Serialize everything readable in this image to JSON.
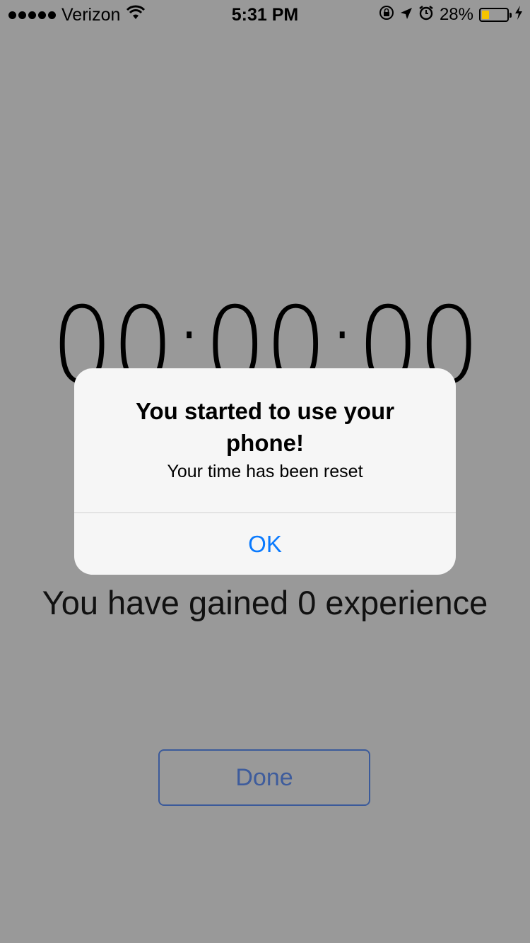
{
  "status_bar": {
    "carrier": "Verizon",
    "time": "5:31 PM",
    "battery_percent": "28%",
    "battery_level": 0.28,
    "icons": [
      "signal-dots",
      "wifi-icon",
      "rotation-lock-icon",
      "location-icon",
      "alarm-icon",
      "battery-icon",
      "charging-icon"
    ]
  },
  "timer": {
    "value": "00:00:00"
  },
  "experience_text": "You have gained 0 experience",
  "done_button": {
    "label": "Done"
  },
  "alert": {
    "title": "You started to use your phone!",
    "message": "Your time has been reset",
    "ok_label": "OK"
  },
  "colors": {
    "dimmed_background": "#999999",
    "alert_background": "#f6f6f6",
    "ios_blue": "#0a7afe",
    "done_button_blue": "#3e5c9c",
    "battery_yellow": "#f5c400"
  }
}
